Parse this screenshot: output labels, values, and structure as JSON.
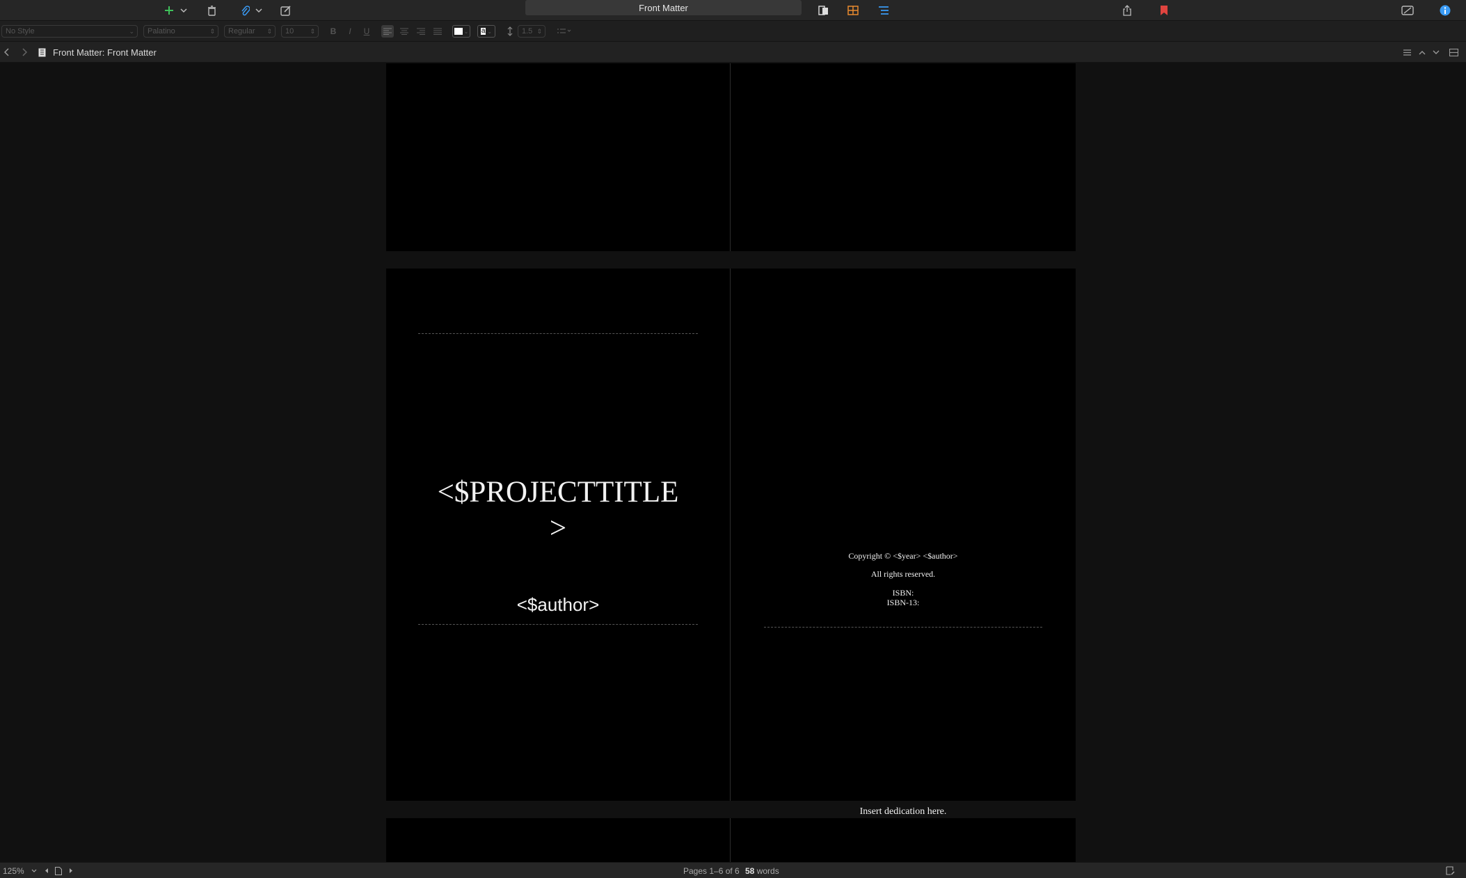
{
  "toolbar": {
    "title": "Front Matter",
    "icons": [
      "add-icon",
      "chevron-down-icon",
      "trash-icon",
      "paperclip-icon",
      "chevron-down-icon",
      "compose-icon",
      "document-view-icon",
      "corkboard-icon",
      "outline-icon",
      "share-icon",
      "bookmark-icon",
      "compose-mode-icon",
      "info-icon"
    ],
    "colors": {
      "add": "#3fc35b",
      "corkboard": "#e88a2e",
      "outline": "#3a9bf5",
      "bookmark": "#e0443f",
      "info": "#3a9bf5"
    }
  },
  "formatbar": {
    "style": "No Style",
    "font": "Palatino",
    "weight": "Regular",
    "size": "10",
    "bold": "B",
    "italic": "I",
    "underline": "U",
    "highlight_letter": "a",
    "line_spacing": "1.5"
  },
  "header": {
    "breadcrumb_prefix": "Front Matter:",
    "breadcrumb_title": "Front Matter"
  },
  "document": {
    "project_title_line1": "<$PROJECTTITLE",
    "project_title_line2": ">",
    "author": "<$author>",
    "copyright": "Copyright © <$year> <$author>",
    "rights": "All rights reserved.",
    "isbn": "ISBN:",
    "isbn13": "ISBN-13:",
    "dedication": "Insert dedication here."
  },
  "status": {
    "zoom": "125%",
    "pages": "Pages 1–6 of 6",
    "word_count": "58",
    "words_label": "words"
  }
}
